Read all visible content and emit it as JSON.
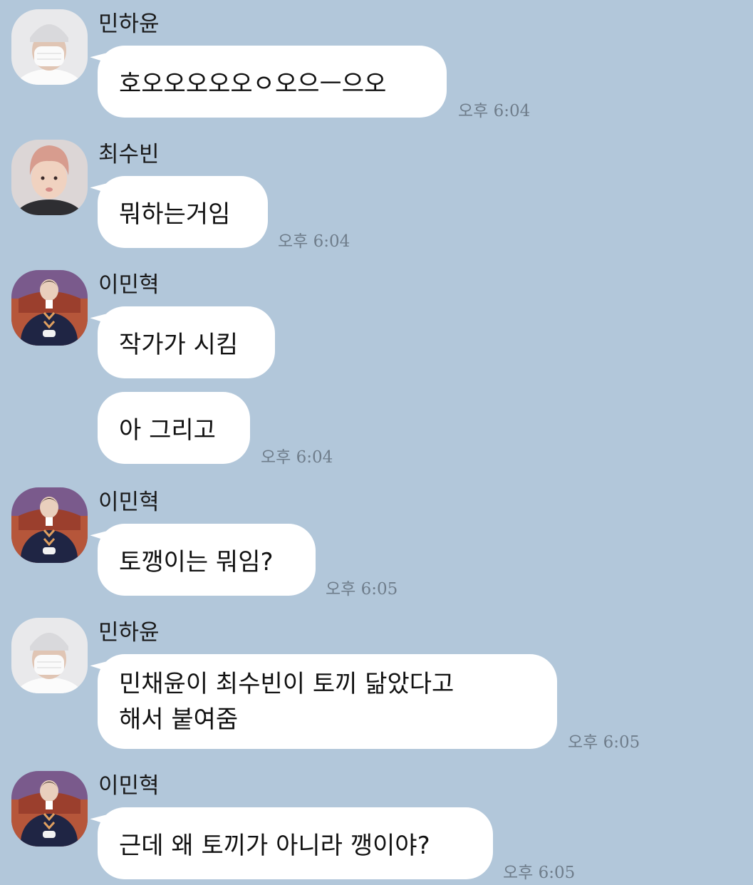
{
  "messages": [
    {
      "sender": "민하윤",
      "text": "호오오오오오ㅇ오으ㅡ으오",
      "time": "오후 6:04"
    },
    {
      "sender": "최수빈",
      "text": "뭐하는거임",
      "time": "오후 6:04"
    },
    {
      "sender": "이민혁",
      "text": "작가가 시킴"
    },
    {
      "text": "아 그리고",
      "time": "오후 6:04"
    },
    {
      "sender": "이민혁",
      "text": "토깽이는 뭐임?",
      "time": "오후 6:05"
    },
    {
      "sender": "민하윤",
      "lines": [
        "민채윤이 최수빈이 토끼 닮았다고",
        "해서 붙여줌"
      ],
      "time": "오후 6:05"
    },
    {
      "sender": "이민혁",
      "text": "근데 왜 토끼가 아니라 깽이야?",
      "time": "오후 6:05"
    }
  ],
  "colors": {
    "background": "#b2c7da",
    "bubble": "#ffffff",
    "timestamp": "#6f7d8b"
  },
  "avatars": [
    "white-beanie-masked-avatar",
    "pink-hair-avatar",
    "navy-sweater-avatar"
  ]
}
